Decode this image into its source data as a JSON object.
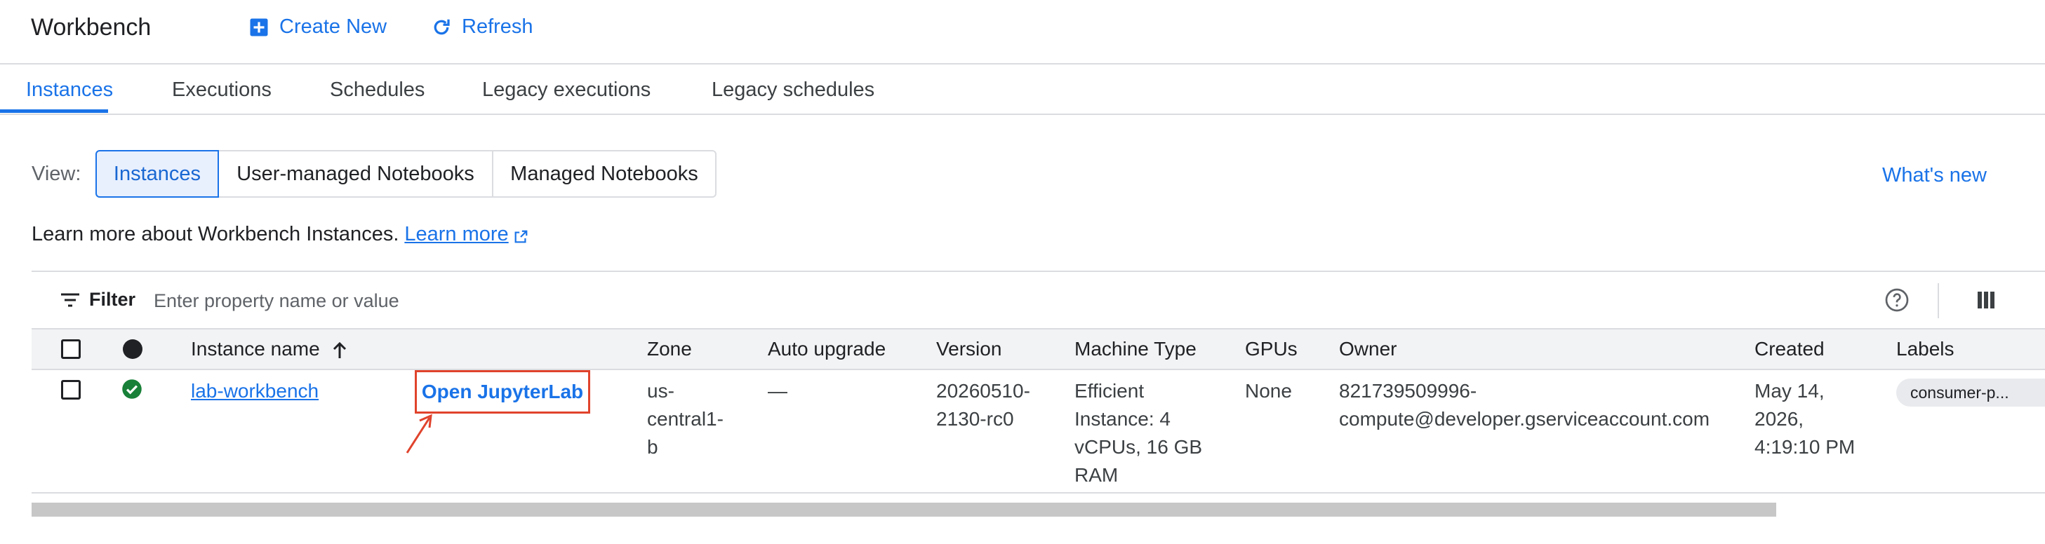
{
  "header": {
    "title": "Workbench",
    "create_label": "Create New",
    "refresh_label": "Refresh"
  },
  "tabs": [
    {
      "label": "Instances",
      "active": true
    },
    {
      "label": "Executions"
    },
    {
      "label": "Schedules"
    },
    {
      "label": "Legacy executions"
    },
    {
      "label": "Legacy schedules"
    }
  ],
  "view": {
    "label": "View:",
    "options": [
      "Instances",
      "User-managed Notebooks",
      "Managed Notebooks"
    ],
    "selected": "Instances"
  },
  "whats_new": "What's new",
  "info": {
    "text": "Learn more about Workbench Instances.",
    "link": "Learn more"
  },
  "filter": {
    "label": "Filter",
    "placeholder": "Enter property name or value"
  },
  "table": {
    "columns": [
      "Instance name",
      "Zone",
      "Auto upgrade",
      "Version",
      "Machine Type",
      "GPUs",
      "Owner",
      "Created",
      "Labels"
    ],
    "rows": [
      {
        "status": "running",
        "name": "lab-workbench",
        "action": "Open JupyterLab",
        "zone": [
          "us-",
          "central1-",
          "b"
        ],
        "auto_upgrade": "—",
        "version": [
          "20260510-",
          "2130-rc0"
        ],
        "machine_type": [
          "Efficient",
          "Instance: 4",
          "vCPUs, 16 GB",
          "RAM"
        ],
        "gpus": "None",
        "owner": [
          "821739509996-",
          "compute@developer.gserviceaccount.com"
        ],
        "created": [
          "May 14,",
          "2026,",
          "4:19:10 PM"
        ],
        "labels": "consumer-p..."
      }
    ]
  },
  "colors": {
    "accent": "#1a73e8",
    "status_ok": "#188038",
    "annotation": "#e0432c"
  }
}
